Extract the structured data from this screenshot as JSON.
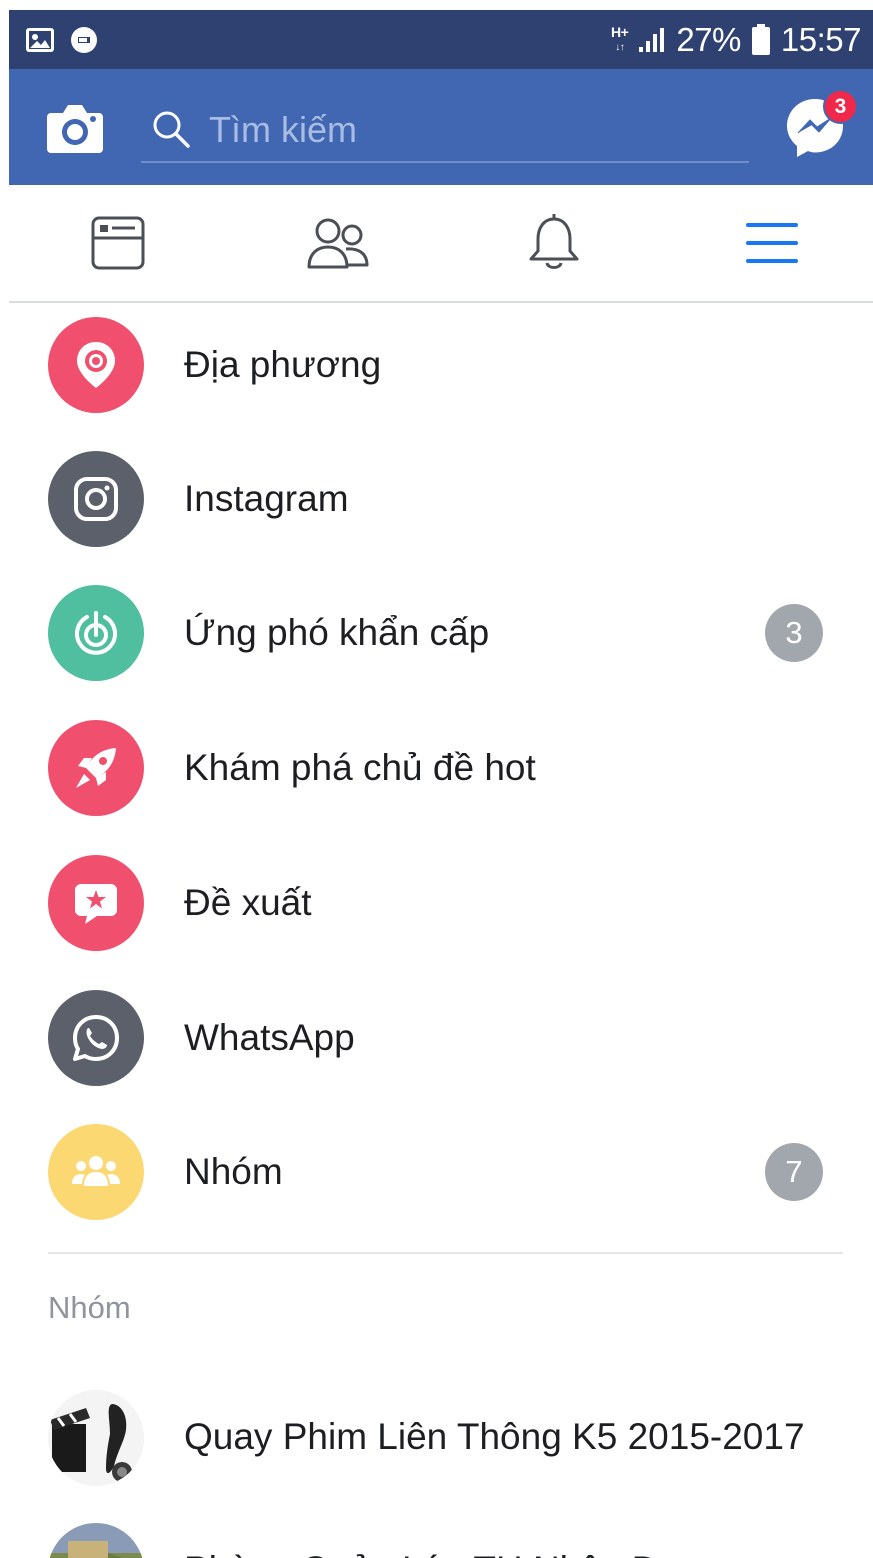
{
  "status_bar": {
    "network": "H+",
    "battery": "27%",
    "time": "15:57",
    "icons": [
      "gallery-icon",
      "data-saver-icon",
      "signal-icon",
      "battery-icon"
    ]
  },
  "top_bar": {
    "search_placeholder": "Tìm kiếm",
    "messenger_badge": "3",
    "icons": [
      "camera-icon",
      "search-icon",
      "messenger-icon"
    ]
  },
  "tabs": [
    {
      "name": "news-feed",
      "icon": "news-feed-icon",
      "active": false
    },
    {
      "name": "friends",
      "icon": "friends-icon",
      "active": false
    },
    {
      "name": "notifications",
      "icon": "bell-icon",
      "active": false
    },
    {
      "name": "menu",
      "icon": "hamburger-icon",
      "active": true
    }
  ],
  "menu": {
    "items": [
      {
        "label": "Địa phương",
        "icon": "location-pin-icon",
        "color": "#f0506e",
        "badge": ""
      },
      {
        "label": "Instagram",
        "icon": "instagram-icon",
        "color": "#5b606b",
        "badge": ""
      },
      {
        "label": "Ứng phó khẩn cấp",
        "icon": "crisis-response-icon",
        "color": "#4fbf9f",
        "badge": "3"
      },
      {
        "label": "Khám phá chủ đề hot",
        "icon": "rocket-icon",
        "color": "#f0506e",
        "badge": ""
      },
      {
        "label": "Đề xuất",
        "icon": "recommendation-star-icon",
        "color": "#f0506e",
        "badge": ""
      },
      {
        "label": "WhatsApp",
        "icon": "whatsapp-icon",
        "color": "#5b606b",
        "badge": ""
      },
      {
        "label": "Nhóm",
        "icon": "groups-icon",
        "color": "#fcd872",
        "badge": "7"
      }
    ]
  },
  "groups_section": {
    "header": "Nhóm",
    "items": [
      {
        "label": "Quay Phim Liên Thông K5 2015-2017",
        "icon": "group-avatar-film"
      },
      {
        "label": "Phòng Quản Lý - TH Nhân Đạo",
        "icon": "group-avatar-landscape"
      }
    ]
  },
  "colors": {
    "status_bar": "#2e4171",
    "brand_blue": "#4267b2",
    "active_tab": "#1877f2",
    "badge_gray": "#a2a6ad",
    "notification_red": "#f02849"
  }
}
